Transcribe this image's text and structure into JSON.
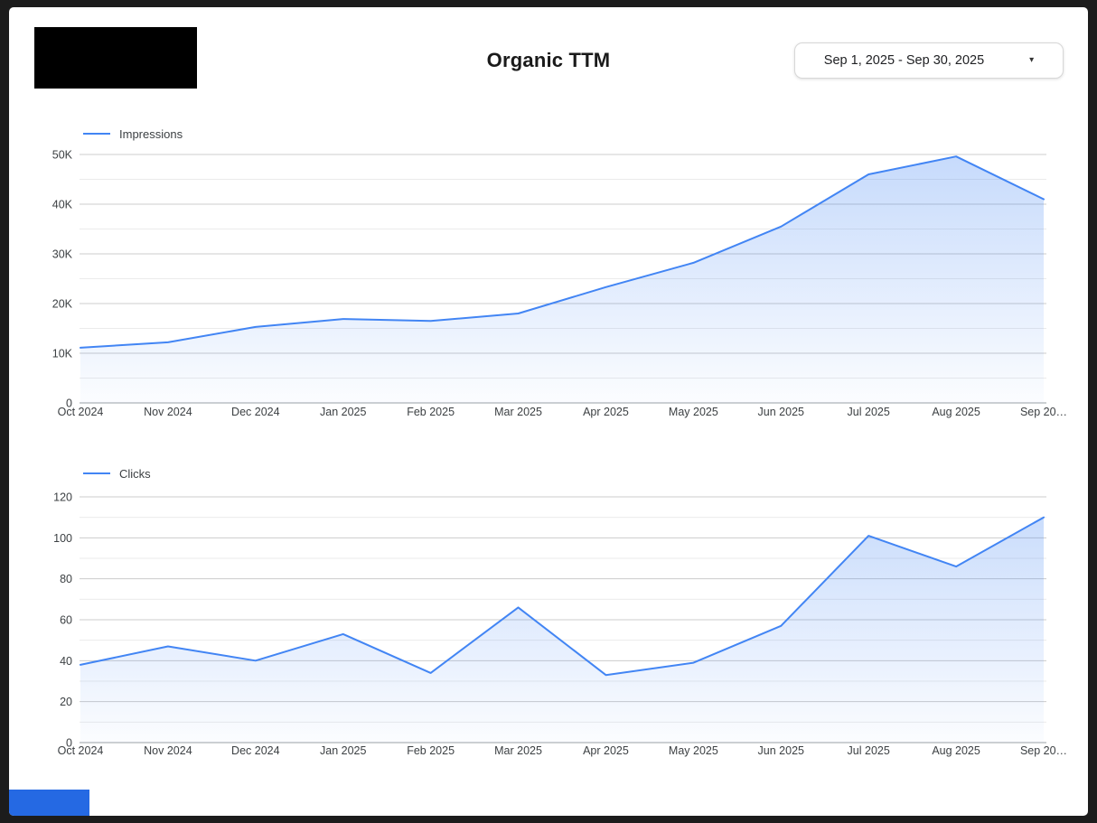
{
  "page": {
    "background": "#ffffff",
    "frame_color": "#1c1c1c"
  },
  "header": {
    "title": "Organic TTM",
    "date_range_label": "Sep 1, 2025 - Sep 30, 2025"
  },
  "icons": {
    "caret_down": "▾"
  },
  "colors": {
    "series_line": "#4285f4",
    "area_fill_top": "rgba(66,133,244,0.30)",
    "area_fill_bottom": "rgba(66,133,244,0.02)",
    "gridline_major": "#cccccc",
    "gridline_minor": "#ebebeb",
    "baseline": "#9aa0a6",
    "tick_text": "#3c4043"
  },
  "chart_data": [
    {
      "type": "area",
      "title": "",
      "categories": [
        "Oct 2024",
        "Nov 2024",
        "Dec 2024",
        "Jan 2025",
        "Feb 2025",
        "Mar 2025",
        "Apr 2025",
        "May 2025",
        "Jun 2025",
        "Jul 2025",
        "Aug 2025",
        "Sep 20…"
      ],
      "series": [
        {
          "name": "Impressions",
          "color": "#4285f4",
          "values": [
            11100,
            12200,
            15300,
            16900,
            16500,
            18000,
            23300,
            28200,
            35500,
            46000,
            49600,
            41000
          ]
        }
      ],
      "xlabel": "",
      "ylabel": "",
      "ylim": [
        0,
        50000
      ],
      "yticks": [
        {
          "v": 0,
          "label": "0"
        },
        {
          "v": 10000,
          "label": "10K"
        },
        {
          "v": 20000,
          "label": "20K"
        },
        {
          "v": 30000,
          "label": "30K"
        },
        {
          "v": 40000,
          "label": "40K"
        },
        {
          "v": 50000,
          "label": "50K"
        }
      ],
      "minor_step": 5000,
      "grid": true,
      "legend_position": "top-left"
    },
    {
      "type": "area",
      "title": "",
      "categories": [
        "Oct 2024",
        "Nov 2024",
        "Dec 2024",
        "Jan 2025",
        "Feb 2025",
        "Mar 2025",
        "Apr 2025",
        "May 2025",
        "Jun 2025",
        "Jul 2025",
        "Aug 2025",
        "Sep 20…"
      ],
      "series": [
        {
          "name": "Clicks",
          "color": "#4285f4",
          "values": [
            38,
            47,
            40,
            53,
            34,
            66,
            33,
            39,
            57,
            101,
            86,
            110
          ]
        }
      ],
      "xlabel": "",
      "ylabel": "",
      "ylim": [
        0,
        120
      ],
      "yticks": [
        {
          "v": 0,
          "label": "0"
        },
        {
          "v": 20,
          "label": "20"
        },
        {
          "v": 40,
          "label": "40"
        },
        {
          "v": 60,
          "label": "60"
        },
        {
          "v": 80,
          "label": "80"
        },
        {
          "v": 100,
          "label": "100"
        },
        {
          "v": 120,
          "label": "120"
        }
      ],
      "minor_step": 10,
      "grid": true,
      "legend_position": "top-left"
    }
  ],
  "footer": {
    "partial_element_color": "#2569e3"
  }
}
